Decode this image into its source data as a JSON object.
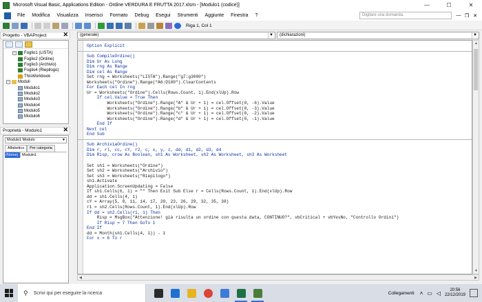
{
  "window": {
    "title": "Microsoft Visual Basic, Applications Edition - Ordine VERDURA E FRUTTA 2017.xlsm - [Modulo1 (codice)]",
    "controls": [
      "—",
      "☐",
      "✕"
    ]
  },
  "menubar": {
    "items": [
      "File",
      "Modifica",
      "Visualizza",
      "Inserisci",
      "Formato",
      "Debug",
      "Esegui",
      "Strumenti",
      "Aggiunte",
      "Finestra",
      "?"
    ],
    "search_placeholder": "Digitare una domanda.",
    "mdi_controls": [
      "—",
      "❐",
      "✕"
    ]
  },
  "toolbar": {
    "status": "Riga 1, Col 1"
  },
  "project_panel": {
    "title": "Progetto - VBAProject",
    "tree": [
      {
        "level": 1,
        "node": "−",
        "icon": "sheet",
        "label": "Foglio1 (LISTA)"
      },
      {
        "level": 1,
        "node": "",
        "icon": "sheet",
        "label": "Foglio2 (Ordine)"
      },
      {
        "level": 1,
        "node": "",
        "icon": "sheet",
        "label": "Foglio3 (Archivio)"
      },
      {
        "level": 1,
        "node": "",
        "icon": "sheet",
        "label": "Foglio4 (Riepilogo)"
      },
      {
        "level": 1,
        "node": "",
        "icon": "book",
        "label": "ThisWorkbook"
      },
      {
        "level": 0,
        "node": "−",
        "icon": "folder",
        "label": "Moduli"
      },
      {
        "level": 1,
        "node": "",
        "icon": "mod",
        "label": "Modulo1"
      },
      {
        "level": 1,
        "node": "",
        "icon": "mod",
        "label": "Modulo2"
      },
      {
        "level": 1,
        "node": "",
        "icon": "mod",
        "label": "Modulo3"
      },
      {
        "level": 1,
        "node": "",
        "icon": "mod",
        "label": "Modulo4"
      },
      {
        "level": 1,
        "node": "",
        "icon": "mod",
        "label": "Modulo5"
      },
      {
        "level": 1,
        "node": "",
        "icon": "mod",
        "label": "Modulo6"
      }
    ]
  },
  "properties_panel": {
    "title": "Proprietà - Modulo1",
    "object_select": "Modulo1 Modulo",
    "tabs": [
      "Alfabetico",
      "Per categoria"
    ],
    "rows": [
      {
        "name": "(Nome)",
        "value": "Modulo1"
      }
    ]
  },
  "code_window": {
    "object_dropdown": "(generale)",
    "procedure_dropdown": "(dichiarazioni)",
    "lines": [
      {
        "text": "Option Explicit",
        "style": "blue"
      },
      {
        "text": "",
        "style": "sep"
      },
      {
        "text": "Sub CompileOrdine()",
        "style": "blue"
      },
      {
        "text": "Dim Ur As Long",
        "style": "blue"
      },
      {
        "text": "Dim rng As Range",
        "style": "blue"
      },
      {
        "text": "Dim cel As Range",
        "style": "blue"
      },
      {
        "text": "Set rng = Worksheets(\"LISTA\").Range(\"g7:g3000\")",
        "style": "plain"
      },
      {
        "text": "Worksheets(\"Ordine\").Range(\"A6:D100\").ClearContents",
        "style": "plain"
      },
      {
        "text": "For Each cel In rng",
        "style": "blue"
      },
      {
        "text": "Ur = Worksheets(\"Ordine\").Cells(Rows.Count, 1).End(xlUp).Row",
        "style": "plain"
      },
      {
        "text": "    If cel.Value = True Then",
        "style": "blue"
      },
      {
        "text": "        Worksheets(\"Ordine\").Range(\"A\" & Ur + 1) = cel.Offset(0, -6).Value",
        "style": "plain"
      },
      {
        "text": "        Worksheets(\"Ordine\").Range(\"b\" & Ur + 1) = cel.Offset(0, -3).Value",
        "style": "plain"
      },
      {
        "text": "        Worksheets(\"Ordine\").Range(\"c\" & Ur + 1) = cel.Offset(0, -2).Value",
        "style": "plain"
      },
      {
        "text": "        Worksheets(\"Ordine\").Range(\"d\" & Ur + 1) = cel.Offset(0, -1).Value",
        "style": "plain"
      },
      {
        "text": "    End If",
        "style": "blue"
      },
      {
        "text": "Next cel",
        "style": "blue"
      },
      {
        "text": "End Sub",
        "style": "blue"
      },
      {
        "text": "",
        "style": "sep"
      },
      {
        "text": "Sub ArchiviaOrdine()",
        "style": "blue"
      },
      {
        "text": "Dim r, rl, cc, cY, r2, c, x, y, z, dd, d1, d2, d3, d4",
        "style": "blue"
      },
      {
        "text": "Dim Risp, crow As Boolean, sh1 As Worksheet, sh2 As Worksheet, sh3 As Worksheet",
        "style": "blue"
      },
      {
        "text": "",
        "style": "plain"
      },
      {
        "text": "Set sh1 = Worksheets(\"Ordine\")",
        "style": "plain"
      },
      {
        "text": "Set sh2 = Worksheets(\"Archivio\")",
        "style": "plain"
      },
      {
        "text": "Set sh3 = Worksheets(\"Riepilogo\")",
        "style": "plain"
      },
      {
        "text": "sh1.Activate",
        "style": "plain"
      },
      {
        "text": "Application.ScreenUpdating = False",
        "style": "plain"
      },
      {
        "text": "If sh1.Cells(6, 1) = \"\" Then Exit Sub Else r = Cells(Rows.Count, 1).End(xlUp).Row",
        "style": "plain"
      },
      {
        "text": "dd = sh1.Cells(4, 1)",
        "style": "plain"
      },
      {
        "text": "cY = Array(5, 8, 11, 14, 17, 20, 23, 26, 29, 32, 35, 38)",
        "style": "plain"
      },
      {
        "text": "r1 = sh2.Cells(Rows.Count, 1).End(xlUp).Row",
        "style": "plain"
      },
      {
        "text": "If dd = sh2.Cells(r1, 1) Then",
        "style": "blue"
      },
      {
        "text": "    Risp = MsgBox(\"Attenzione! già risulta un ordine con questa data, CONTINUO?\", vbCritical + vbYesNo, \"Controllo Ordini\")",
        "style": "plain"
      },
      {
        "text": "    If Risp = 7 Then GoTo 1",
        "style": "blue"
      },
      {
        "text": "End If",
        "style": "blue"
      },
      {
        "text": "dd = Month(sh1.Cells(4, 1)) - 1",
        "style": "plain"
      },
      {
        "text": "For x = 6 To r",
        "style": "blue"
      }
    ]
  },
  "taskbar": {
    "search_placeholder": "Scrivi qui per eseguire la ricerca",
    "apps": [
      {
        "name": "task-view",
        "color": "#2b2b2b"
      },
      {
        "name": "edge",
        "color": "#1f6fd1"
      },
      {
        "name": "file-explorer",
        "color": "#e6b422"
      },
      {
        "name": "chrome",
        "color": "#db4437"
      },
      {
        "name": "store",
        "color": "#3f7bd6"
      },
      {
        "name": "excel",
        "color": "#1e7145"
      },
      {
        "name": "vba-editor",
        "color": "#4a7d3a"
      }
    ],
    "network_label": "Collegamenti",
    "time": "20:56",
    "date": "22/12/2019"
  }
}
